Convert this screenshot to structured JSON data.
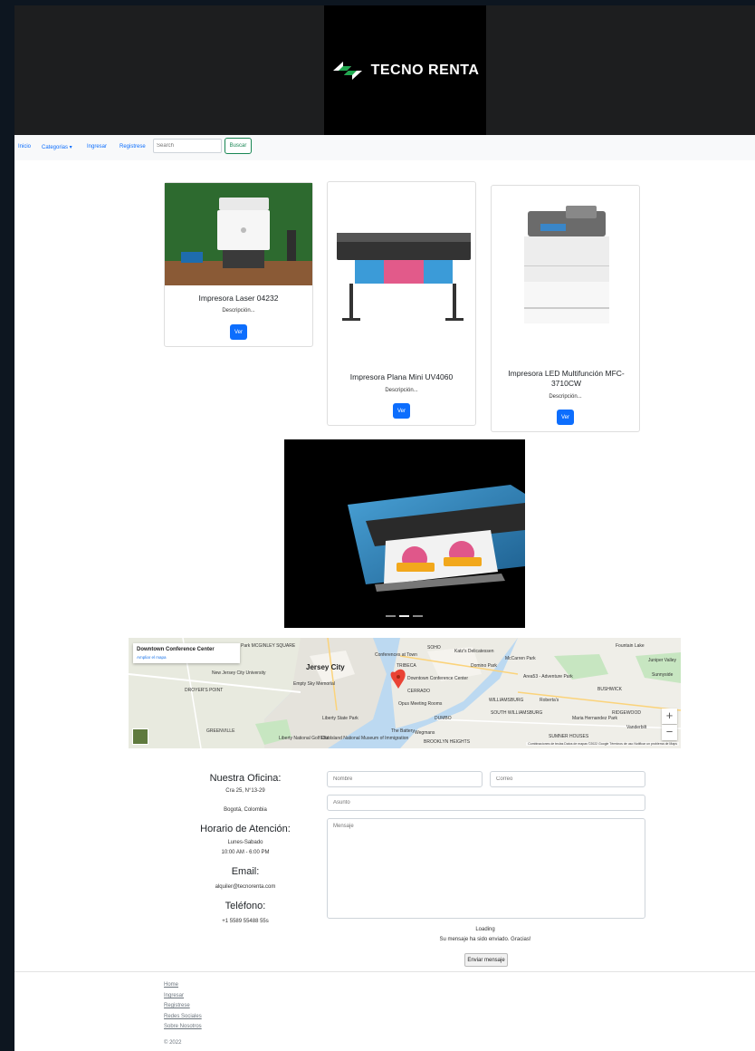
{
  "brand": {
    "name": "TECNO RENTA",
    "logo_icon": "arrows-exchange-icon"
  },
  "navbar": {
    "items": [
      "Inicio",
      "Categorias",
      "Ingresar",
      "Registrese"
    ],
    "search_placeholder": "Search",
    "search_button": "Buscar"
  },
  "products": [
    {
      "title": "Impresora Laser 04232",
      "description": "Descripción...",
      "button": "Ver"
    },
    {
      "title": "Impresora Plana Mini UV4060",
      "description": "Descripción...",
      "button": "Ver"
    },
    {
      "title": "Impresora LED Multifunción MFC-3710CW",
      "description": "Descripción...",
      "button": "Ver"
    }
  ],
  "carousel": {
    "slide_count": 3,
    "active_index": 1
  },
  "map": {
    "place": "Downtown Conference Center",
    "enlarge": "Ampliar el mapa",
    "labels": [
      "Jersey City",
      "Park MCGINLEY SQUARE",
      "New Jersey City University",
      "DROYER'S POINT",
      "GREENVILLE",
      "Liberty State Park",
      "Liberty National Golf Club",
      "Ellis Island National Museum of Immigration",
      "The Battery",
      "Conferences at Town",
      "SOHO",
      "Katz's Delicatessen",
      "McCarren Park",
      "TRIBECA",
      "Domino Park",
      "Downtown Conference Center",
      "CERRADO",
      "Opus Meeting Rooms",
      "DUMBO",
      "WILLIAMSBURG",
      "SOUTH WILLIAMSBURG",
      "Area53 - Adventure Park",
      "Roberta's",
      "RIDGEWOOD",
      "Maria Hernandez Park",
      "BROOKLYN HEIGHTS",
      "SUMNER HOUSES",
      "Empty Sky Memorial",
      "Wegmans",
      "Fountain Lake",
      "Juniper Valley",
      "Sunnyside",
      "BUSHWICK",
      "Vanderbilt"
    ],
    "footer": "Combinaciones de teclas   Datos de mapas ©2022 Google   Términos de uso   Notificar un problema de Maps",
    "zoom_in": "+",
    "zoom_out": "−"
  },
  "office": {
    "office_heading": "Nuestra Oficina:",
    "address": "Cra 25, N°13-29",
    "city": "Bogotá, Colombia",
    "hours_heading": "Horario de Atención:",
    "days": "Lunes-Sabado",
    "hours": "10:00 AM - 6:00 PM",
    "email_heading": "Email:",
    "email": "alquiler@tecnorenta.com",
    "phone_heading": "Teléfono:",
    "phone": "+1 5589 55488 55s"
  },
  "form": {
    "name_placeholder": "Nombre",
    "email_placeholder": "Correo",
    "subject_placeholder": "Asunto",
    "message_placeholder": "Mensaje",
    "loading": "Loading",
    "sent_message": "Su mensaje ha sido enviado. Gracias!",
    "submit": "Enviar mensaje"
  },
  "footer": {
    "links": [
      "Home",
      "Ingresar",
      "Registrese",
      "Redes Sociales",
      "Sobre Nosotros"
    ],
    "copyright": "© 2022"
  }
}
